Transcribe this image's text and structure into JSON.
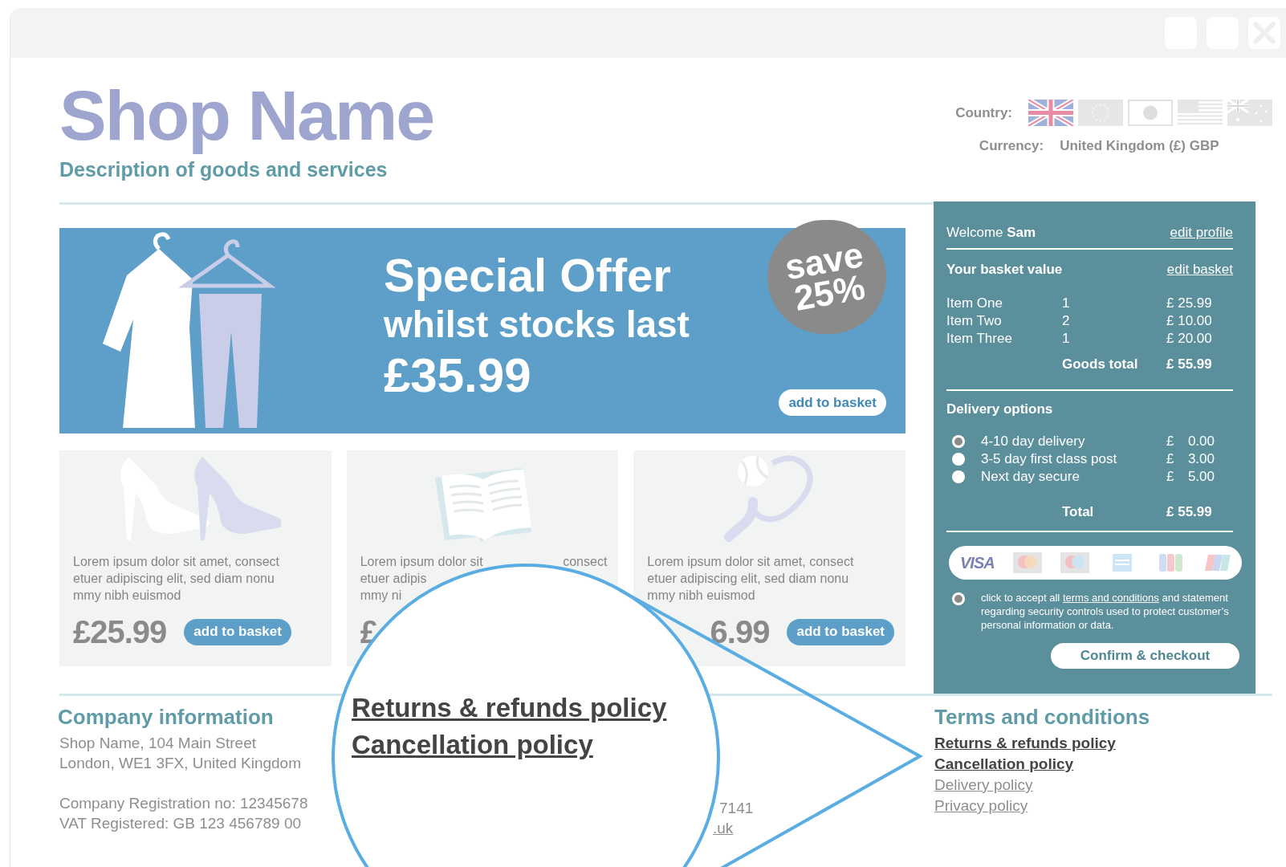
{
  "header": {
    "shop_name": "Shop Name",
    "description": "Description of goods and services",
    "country_label": "Country:",
    "flags": [
      {
        "kind": "uk",
        "selected": true
      },
      {
        "kind": "eu",
        "selected": false
      },
      {
        "kind": "jp",
        "selected": false
      },
      {
        "kind": "us",
        "selected": false
      },
      {
        "kind": "au",
        "selected": false
      }
    ],
    "currency_label": "Currency:",
    "currency": "United Kingdom (£) GBP"
  },
  "offer": {
    "title": "Special Offer",
    "subtitle": "whilst stocks last",
    "price": "£35.99",
    "badge": "save 25%",
    "button": "add to basket"
  },
  "products": [
    {
      "kind": "shoes",
      "lines": [
        [
          "Lorem ipsum dolor sit amet, consect"
        ],
        [
          "etuer adipiscing elit, sed diam nonu"
        ],
        [
          "mmy nibh euismod"
        ]
      ],
      "price": "£25.99",
      "button": "add to basket"
    },
    {
      "kind": "book",
      "lines": [
        [
          "Lorem ipsum dolor sit",
          "consect"
        ],
        [
          "etuer adipis"
        ],
        [
          "mmy ni"
        ]
      ],
      "price": "£"
    },
    {
      "kind": "racket",
      "lines": [
        [
          "Lorem ipsum dolor sit amet, consect"
        ],
        [
          "etuer adipiscing elit, sed diam nonu"
        ],
        [
          "mmy nibh euismod"
        ]
      ],
      "price": "6.99",
      "button": "add to basket"
    }
  ],
  "sidebar": {
    "welcome": "Welcome **Sam**",
    "edit_profile": "edit profile",
    "basket_title": "Your basket value",
    "edit_basket": "edit basket",
    "items": [
      {
        "name": "Item One",
        "qty": "1",
        "price": "£ 25.99"
      },
      {
        "name": "Item Two",
        "qty": "2",
        "price": "£ 10.00"
      },
      {
        "name": "Item Three",
        "qty": "1",
        "price": "£ 20.00"
      }
    ],
    "goods_total_label": "Goods total",
    "goods_total": "£ 55.99",
    "delivery_title": "Delivery options",
    "delivery": [
      {
        "label": "4-10 day delivery",
        "currency": "£",
        "amount": "0.00",
        "selected": true
      },
      {
        "label": "3-5 day first class post",
        "currency": "£",
        "amount": "3.00",
        "selected": false
      },
      {
        "label": "Next day secure",
        "currency": "£",
        "amount": "5.00",
        "selected": false
      }
    ],
    "total_label": "Total",
    "total": "£ 55.99",
    "payment_methods": [
      {
        "kind": "visa",
        "label": "VISA"
      },
      {
        "kind": "mastercard"
      },
      {
        "kind": "maestro"
      },
      {
        "kind": "amex"
      },
      {
        "kind": "jcb"
      },
      {
        "kind": "unionpay"
      }
    ],
    "accept": {
      "selected": true,
      "before": "click to accept all",
      "link": "terms and conditions",
      "after": "and statement regarding security controls used to protect customer’s personal information or data."
    },
    "checkout": "Confirm & checkout"
  },
  "footer": {
    "company_title": "Company information",
    "company_blocks": [
      [
        "Shop Name, 104 Main Street",
        "London, WE1 3FX, United Kingdom"
      ],
      [
        "Company Registration no: 12345678",
        "VAT Registered: GB 123 456789 00"
      ]
    ],
    "contact": [
      {
        "kind": "text",
        "text": "7141"
      },
      {
        "kind": "link",
        "text": ".uk"
      }
    ],
    "terms_title": "Terms and conditions",
    "terms_links": [
      {
        "text": "Returns & refunds policy",
        "highlighted": true
      },
      {
        "text": "Cancellation policy",
        "highlighted": true
      },
      {
        "text": "Delivery policy",
        "highlighted": false
      },
      {
        "text": "Privacy policy",
        "highlighted": false
      }
    ]
  },
  "magnifier": {
    "links": [
      "Returns & refunds policy",
      "Cancellation policy"
    ]
  }
}
